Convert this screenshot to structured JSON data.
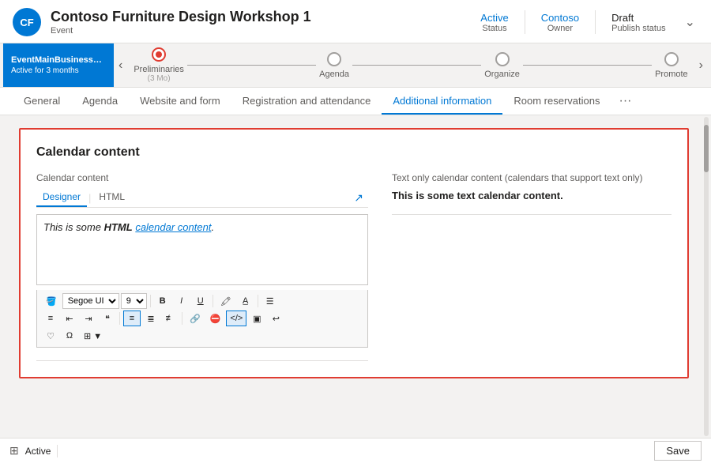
{
  "header": {
    "avatar_initials": "CF",
    "event_title": "Contoso Furniture Design Workshop 1",
    "event_type": "Event",
    "status": {
      "value": "Active",
      "label": "Status"
    },
    "owner": {
      "value": "Contoso",
      "label": "Owner"
    },
    "publish_status": {
      "value": "Draft",
      "label": "Publish status"
    }
  },
  "timeline": {
    "active_title": "EventMainBusinessProce...",
    "active_sub": "Active for 3 months",
    "steps": [
      {
        "label": "Preliminaries",
        "sublabel": "(3 Mo)",
        "state": "active"
      },
      {
        "label": "Agenda",
        "sublabel": "",
        "state": "empty"
      },
      {
        "label": "Organize",
        "sublabel": "",
        "state": "empty"
      },
      {
        "label": "Promote",
        "sublabel": "",
        "state": "empty"
      }
    ]
  },
  "tabs": [
    {
      "label": "General",
      "active": false
    },
    {
      "label": "Agenda",
      "active": false
    },
    {
      "label": "Website and form",
      "active": false
    },
    {
      "label": "Registration and attendance",
      "active": false
    },
    {
      "label": "Additional information",
      "active": true
    },
    {
      "label": "Room reservations",
      "active": false
    }
  ],
  "tabs_more": "···",
  "content": {
    "card_title": "Calendar content",
    "left": {
      "field_label": "Calendar content",
      "editor_tab_designer": "Designer",
      "editor_tab_html": "HTML",
      "rich_text_italic": "This is some ",
      "rich_text_bold": "HTML",
      "rich_text_link_text": "calendar content",
      "rich_text_after": ".",
      "toolbar": {
        "font_select": "Segoe UI",
        "size_select": "9",
        "bold": "B",
        "italic": "I",
        "underline": "U"
      }
    },
    "right": {
      "label": "Text only calendar content (calendars that support text only)",
      "text": "This is some text calendar content."
    }
  },
  "bottom": {
    "status_icon": "⊞",
    "status_text": "Active",
    "save_label": "Save"
  }
}
